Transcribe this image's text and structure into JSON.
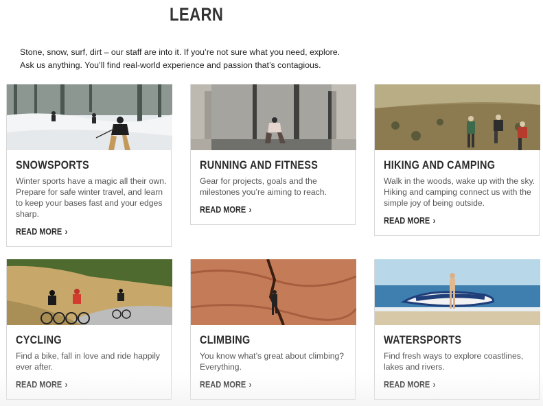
{
  "page": {
    "title": "LEARN",
    "intro_line1": "Stone, snow, surf, dirt – our staff are into it. If you’re not sure what you need, explore.",
    "intro_line2": "Ask us anything. You’ll find real-world experience and passion that’s contagious."
  },
  "cards": [
    {
      "title": "SNOWSPORTS",
      "desc": "Winter sports have a magic all their own. Prepare for safe winter travel, and learn to keep your bases fast and your edges sharp.",
      "read_more": "READ MORE",
      "image": "skier-in-snowy-forest"
    },
    {
      "title": "RUNNING AND FITNESS",
      "desc": "Gear for projects, goals and the milestones you’re aiming to reach.",
      "read_more": "READ MORE",
      "image": "person-squatting-in-gym"
    },
    {
      "title": "HIKING AND CAMPING",
      "desc": "Walk in the woods, wake up with the sky. Hiking and camping connect us with the simple joy of being outside.",
      "read_more": "READ MORE",
      "image": "hikers-on-hillside"
    },
    {
      "title": "CYCLING",
      "desc": "Find a bike, fall in love and ride happily ever after.",
      "read_more": "READ MORE",
      "image": "cyclists-on-road"
    },
    {
      "title": "CLIMBING",
      "desc": "You know what’s great about climbing? Everything.",
      "read_more": "READ MORE",
      "image": "climber-on-rock-crack"
    },
    {
      "title": "WATERSPORTS",
      "desc": "Find fresh ways to explore coastlines, lakes and rivers.",
      "read_more": "READ MORE",
      "image": "person-with-paddleboard-on-beach"
    }
  ],
  "colors": {
    "text_dark": "#2b2b2b",
    "text_body": "#555555",
    "card_border": "#d8d8d8"
  },
  "icons": {
    "read_more": "chevron-right-icon"
  }
}
